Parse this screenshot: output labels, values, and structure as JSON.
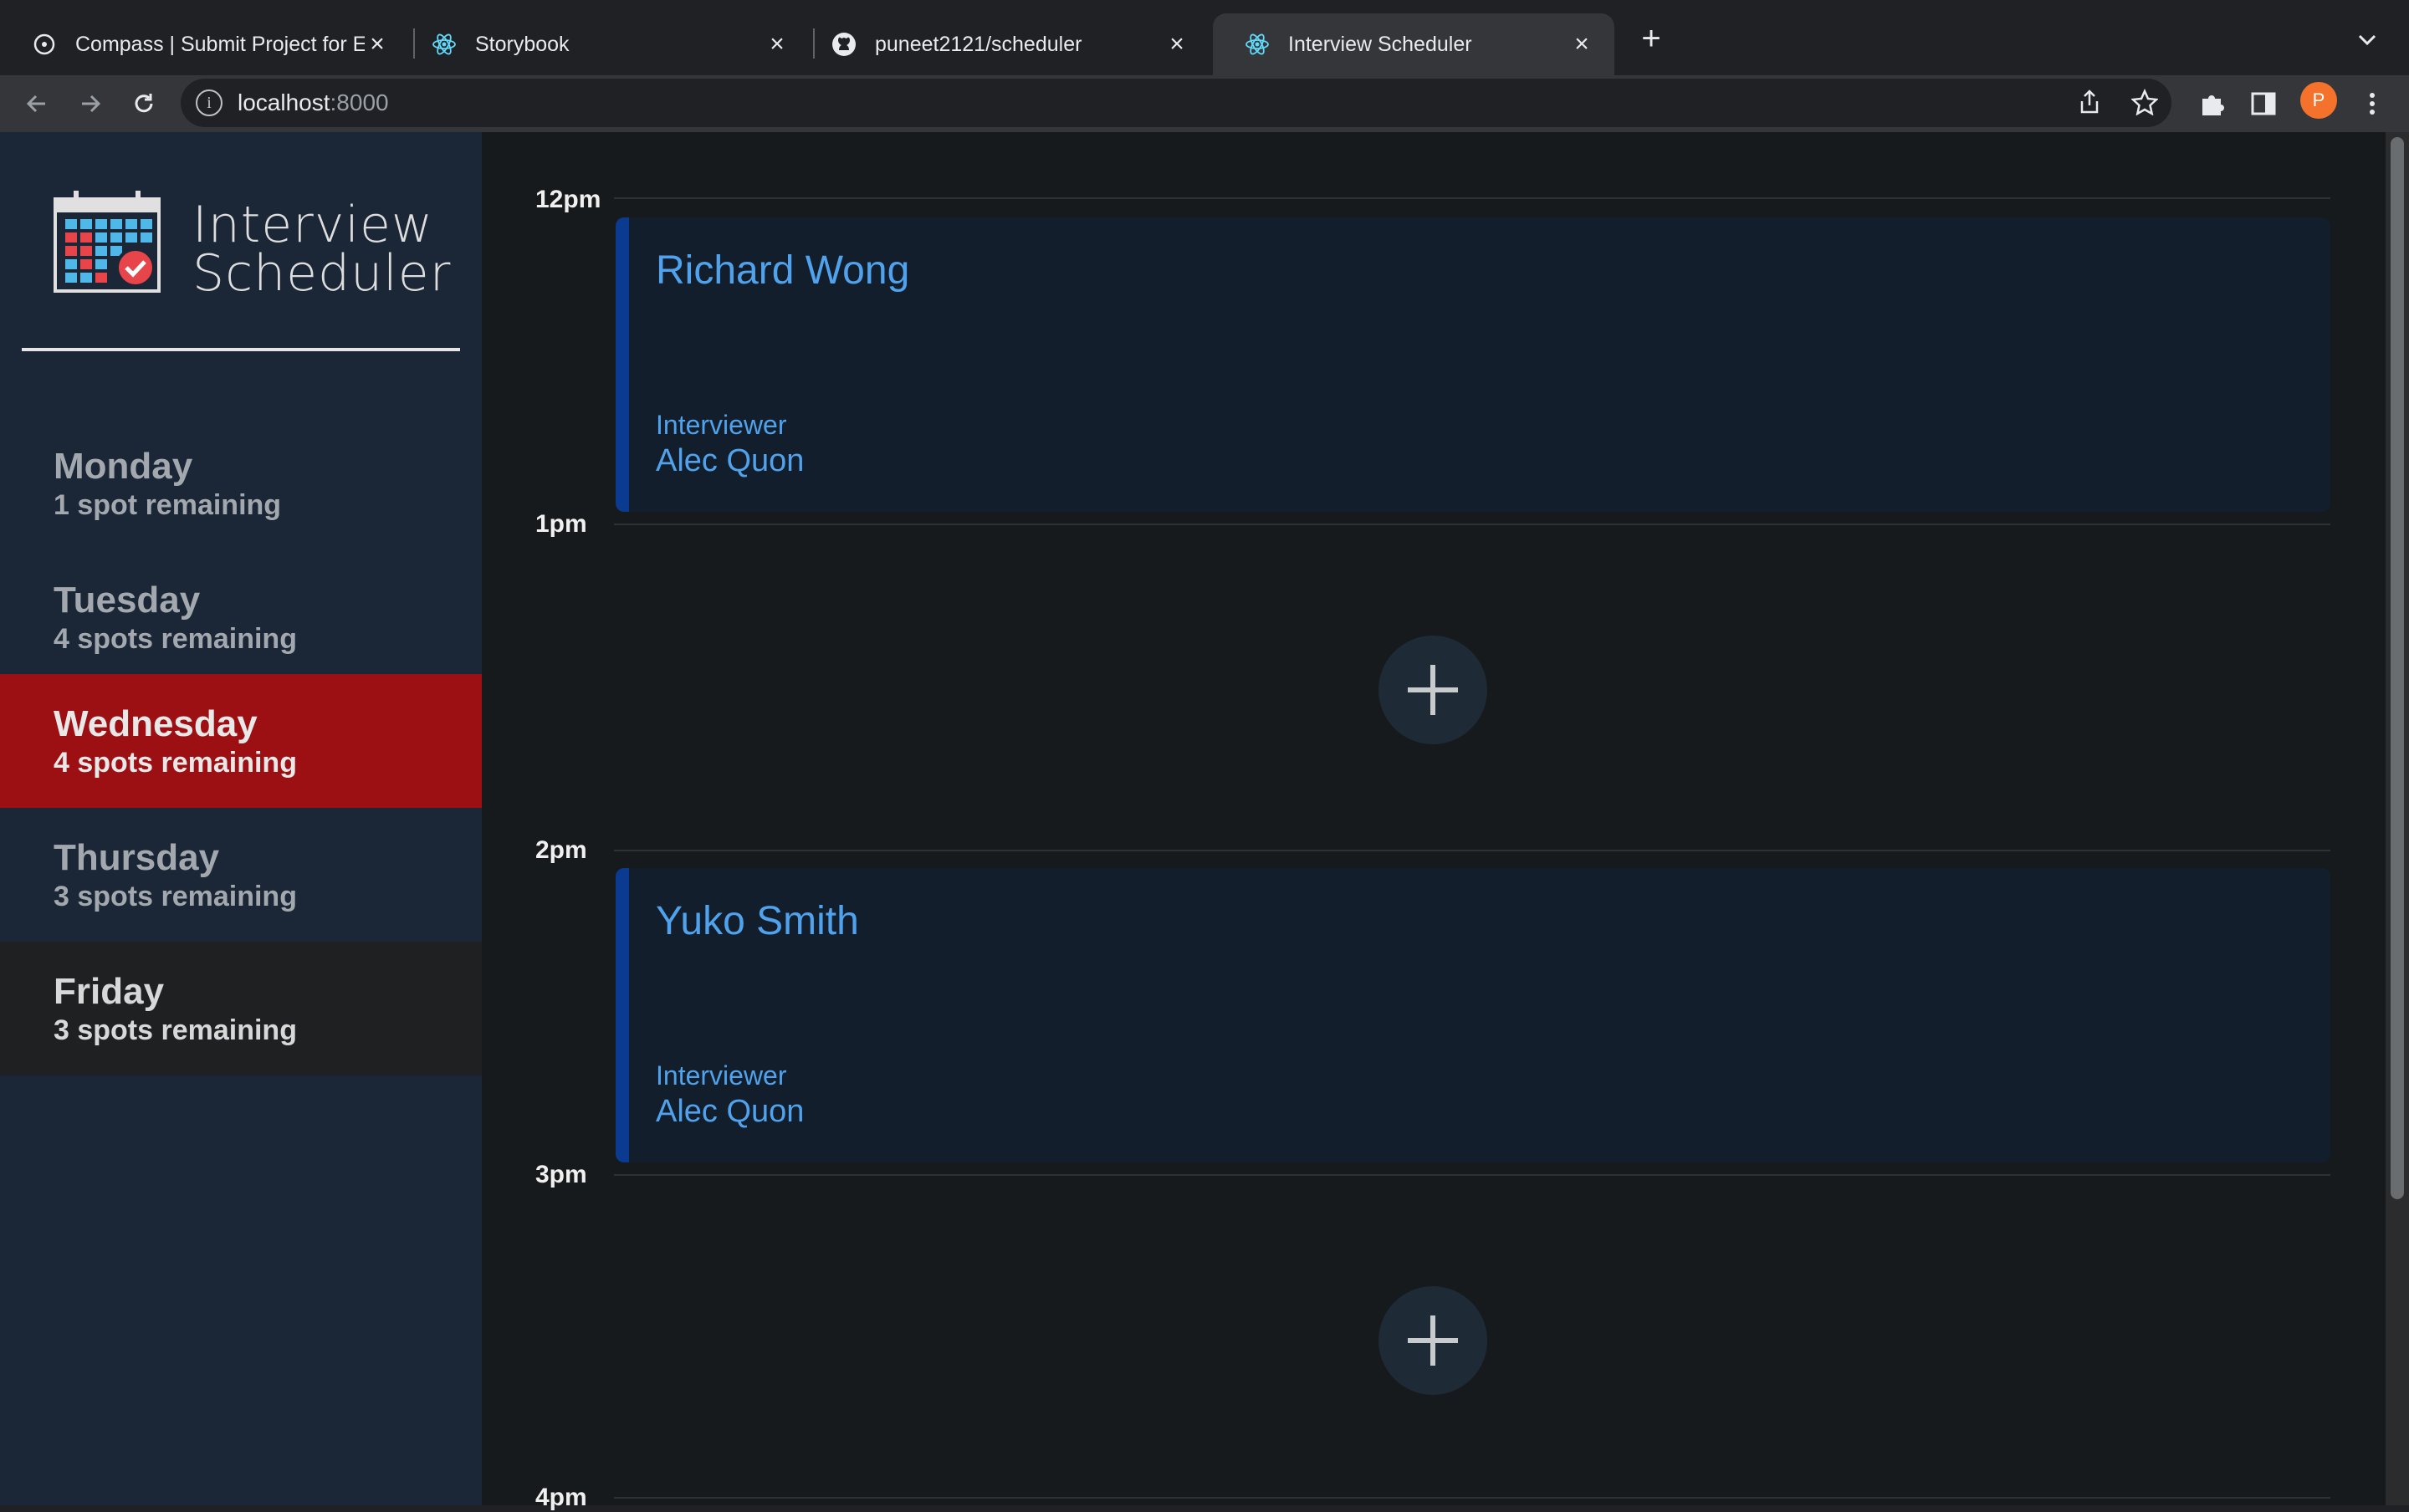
{
  "browser": {
    "tabs": [
      {
        "label": "Compass | Submit Project for E",
        "icon": "compass-icon",
        "active": false
      },
      {
        "label": "Storybook",
        "icon": "react-icon",
        "active": false
      },
      {
        "label": "puneet2121/scheduler",
        "icon": "github-icon",
        "active": false
      },
      {
        "label": "Interview Scheduler",
        "icon": "react-icon",
        "active": true
      }
    ],
    "url_host": "localhost",
    "url_port": ":8000",
    "profile_initial": "P"
  },
  "sidebar": {
    "logo_line1": "Interview",
    "logo_line2": "Scheduler",
    "days": [
      {
        "name": "Monday",
        "spots": "1 spot remaining",
        "state": "normal"
      },
      {
        "name": "Tuesday",
        "spots": "4 spots remaining",
        "state": "normal"
      },
      {
        "name": "Wednesday",
        "spots": "4 spots remaining",
        "state": "selected"
      },
      {
        "name": "Thursday",
        "spots": "3 spots remaining",
        "state": "normal"
      },
      {
        "name": "Friday",
        "spots": "3 spots remaining",
        "state": "full"
      }
    ]
  },
  "schedule": {
    "times": [
      "12pm",
      "1pm",
      "2pm",
      "3pm",
      "4pm"
    ],
    "appointments": [
      {
        "student": "Richard Wong",
        "interviewer_label": "Interviewer",
        "interviewer": "Alec Quon"
      },
      {
        "student": "Yuko Smith",
        "interviewer_label": "Interviewer",
        "interviewer": "Alec Quon"
      }
    ]
  },
  "colors": {
    "selected_day": "#9c1014",
    "sidebar_bg": "#1b2737",
    "accent_blue": "#4fa2eb"
  }
}
